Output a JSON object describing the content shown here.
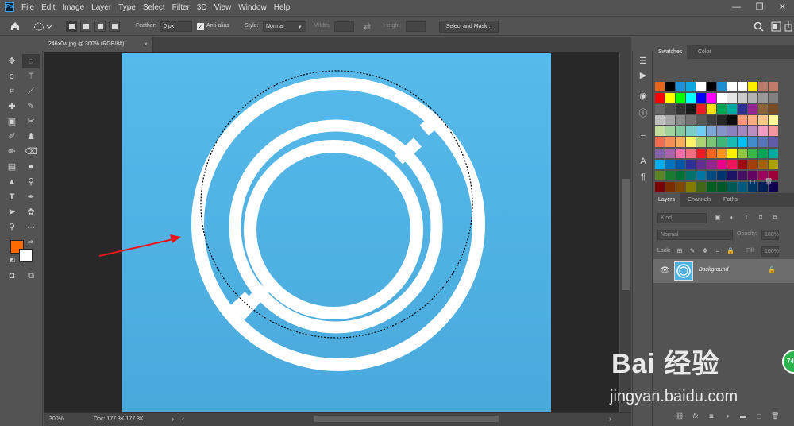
{
  "menubar": {
    "logo": "Ps",
    "items": [
      "File",
      "Edit",
      "Image",
      "Layer",
      "Type",
      "Select",
      "Filter",
      "3D",
      "View",
      "Window",
      "Help"
    ],
    "window_controls": [
      "—",
      "❐",
      "✕"
    ]
  },
  "options": {
    "feather_label": "Feather:",
    "feather_value": "0 px",
    "antialias_label": "Anti-alias",
    "style_label": "Style:",
    "style_value": "Normal",
    "width_label": "Width:",
    "height_label": "Height:",
    "select_mask_label": "Select and Mask..."
  },
  "document": {
    "tab_title": "246x0w.jpg @ 300% (RGB/8#)",
    "close_glyph": "×",
    "zoom": "300%",
    "doc_info": "Doc: 177.3K/177.3K"
  },
  "tools": {
    "foreground_color": "#ff6a00",
    "background_color": "#ffffff"
  },
  "swatches_panel": {
    "tabs": [
      "Swatches",
      "Color"
    ],
    "colors": [
      [
        "#e8631b",
        "#000000",
        "#1e90d8",
        "#0fa7e0",
        "#ffffff",
        "#000000",
        "#1e8ed2",
        "#ffffff",
        "#ffffff",
        "#ffee00",
        "#b97a6a",
        "#c07b6b"
      ],
      [
        "#ff0000",
        "#ffff00",
        "#00ff00",
        "#00ffff",
        "#0000ff",
        "#ff00ff",
        "#ffffff",
        "#e6e6e6",
        "#cccccc",
        "#b3b3b3",
        "#999999",
        "#808080"
      ],
      [
        "#666666",
        "#4d4d4d",
        "#333333",
        "#1a1a1a",
        "#ed1c24",
        "#ffde17",
        "#00a651",
        "#00a99d",
        "#2e3192",
        "#92278f",
        "#8c6239",
        "#754c24"
      ],
      [
        "#bfbfbf",
        "#a6a6a6",
        "#8c8c8c",
        "#737373",
        "#595959",
        "#404040",
        "#262626",
        "#0d0d0d",
        "#f7977a",
        "#f9ad81",
        "#fdc68a",
        "#fff79a"
      ],
      [
        "#c4df9b",
        "#a3d39c",
        "#82ca9d",
        "#7bcdc8",
        "#6ecff6",
        "#7ea7d8",
        "#8493ca",
        "#8882be",
        "#a187be",
        "#bc8dbf",
        "#f49ac1",
        "#f5989d"
      ],
      [
        "#f26c4f",
        "#f68e55",
        "#fbaf5c",
        "#fff467",
        "#acd372",
        "#7cc576",
        "#3bb878",
        "#1abbb4",
        "#00bff3",
        "#438ccb",
        "#5574b9",
        "#605ca8"
      ],
      [
        "#855fa8",
        "#a763a8",
        "#f06ea9",
        "#f26d7d",
        "#ed1c24",
        "#f26522",
        "#f7941d",
        "#fff200",
        "#8dc63f",
        "#39b54a",
        "#00a651",
        "#00a99d"
      ],
      [
        "#00aeef",
        "#0072bc",
        "#0054a6",
        "#2e3192",
        "#662d91",
        "#92278f",
        "#ec008c",
        "#ed145b",
        "#9e0b0f",
        "#a0410d",
        "#a3620a",
        "#aba000"
      ],
      [
        "#598527",
        "#1a7b30",
        "#007236",
        "#00746b",
        "#0076a3",
        "#004a80",
        "#003471",
        "#1b1464",
        "#440e62",
        "#630460",
        "#9e005d",
        "#9e0039"
      ],
      [
        "#790000",
        "#7b2e00",
        "#7d4900",
        "#827b00",
        "#406618",
        "#005e20",
        "#005826",
        "#005952",
        "#005b7f",
        "#003663",
        "#002157",
        "#0d004c"
      ]
    ]
  },
  "layers_panel": {
    "tabs": [
      "Layers",
      "Channels",
      "Paths"
    ],
    "kind_placeholder": "Kind",
    "blend_mode": "Normal",
    "opacity_label": "Opacity:",
    "opacity_value": "100%",
    "lock_label": "Lock:",
    "fill_label": "Fill:",
    "fill_value": "100%",
    "layer_name": "Background"
  },
  "watermark": {
    "brand": "Bai 经验",
    "url": "jingyan.baidu.com",
    "badge": "74"
  }
}
